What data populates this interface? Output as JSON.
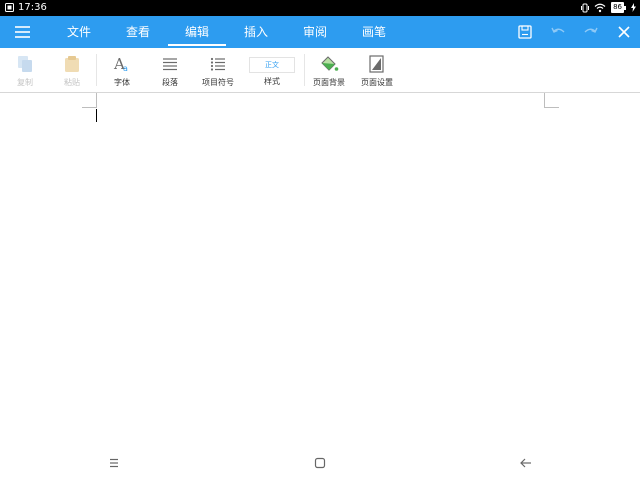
{
  "status_bar": {
    "time": "17:36",
    "battery": "86"
  },
  "app_bar": {
    "tabs": [
      {
        "label": "文件"
      },
      {
        "label": "查看"
      },
      {
        "label": "编辑"
      },
      {
        "label": "插入"
      },
      {
        "label": "审阅"
      },
      {
        "label": "画笔"
      }
    ],
    "active_tab": 2,
    "accent": "#2d9cf0"
  },
  "ribbon": {
    "copy": "复制",
    "paste": "粘贴",
    "font": "字体",
    "paragraph": "段落",
    "bullets": "项目符号",
    "style": "样式",
    "style_preview": "正文",
    "page_background": "页面背景",
    "page_setup": "页面设置"
  },
  "icons": {
    "menu": "hamburger-menu-icon",
    "save": "save-icon",
    "undo": "undo-icon",
    "redo": "redo-icon",
    "close": "close-icon"
  }
}
